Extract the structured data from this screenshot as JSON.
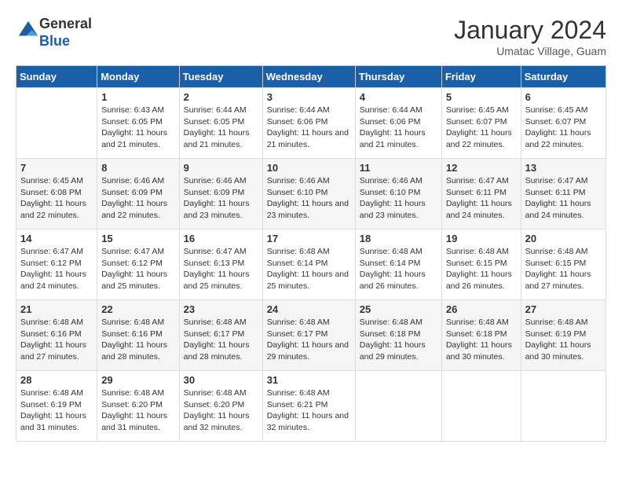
{
  "header": {
    "logo_line1": "General",
    "logo_line2": "Blue",
    "month": "January 2024",
    "location": "Umatac Village, Guam"
  },
  "days_of_week": [
    "Sunday",
    "Monday",
    "Tuesday",
    "Wednesday",
    "Thursday",
    "Friday",
    "Saturday"
  ],
  "weeks": [
    [
      {
        "num": "",
        "sunrise": "",
        "sunset": "",
        "daylight": ""
      },
      {
        "num": "1",
        "sunrise": "Sunrise: 6:43 AM",
        "sunset": "Sunset: 6:05 PM",
        "daylight": "Daylight: 11 hours and 21 minutes."
      },
      {
        "num": "2",
        "sunrise": "Sunrise: 6:44 AM",
        "sunset": "Sunset: 6:05 PM",
        "daylight": "Daylight: 11 hours and 21 minutes."
      },
      {
        "num": "3",
        "sunrise": "Sunrise: 6:44 AM",
        "sunset": "Sunset: 6:06 PM",
        "daylight": "Daylight: 11 hours and 21 minutes."
      },
      {
        "num": "4",
        "sunrise": "Sunrise: 6:44 AM",
        "sunset": "Sunset: 6:06 PM",
        "daylight": "Daylight: 11 hours and 21 minutes."
      },
      {
        "num": "5",
        "sunrise": "Sunrise: 6:45 AM",
        "sunset": "Sunset: 6:07 PM",
        "daylight": "Daylight: 11 hours and 22 minutes."
      },
      {
        "num": "6",
        "sunrise": "Sunrise: 6:45 AM",
        "sunset": "Sunset: 6:07 PM",
        "daylight": "Daylight: 11 hours and 22 minutes."
      }
    ],
    [
      {
        "num": "7",
        "sunrise": "Sunrise: 6:45 AM",
        "sunset": "Sunset: 6:08 PM",
        "daylight": "Daylight: 11 hours and 22 minutes."
      },
      {
        "num": "8",
        "sunrise": "Sunrise: 6:46 AM",
        "sunset": "Sunset: 6:09 PM",
        "daylight": "Daylight: 11 hours and 22 minutes."
      },
      {
        "num": "9",
        "sunrise": "Sunrise: 6:46 AM",
        "sunset": "Sunset: 6:09 PM",
        "daylight": "Daylight: 11 hours and 23 minutes."
      },
      {
        "num": "10",
        "sunrise": "Sunrise: 6:46 AM",
        "sunset": "Sunset: 6:10 PM",
        "daylight": "Daylight: 11 hours and 23 minutes."
      },
      {
        "num": "11",
        "sunrise": "Sunrise: 6:46 AM",
        "sunset": "Sunset: 6:10 PM",
        "daylight": "Daylight: 11 hours and 23 minutes."
      },
      {
        "num": "12",
        "sunrise": "Sunrise: 6:47 AM",
        "sunset": "Sunset: 6:11 PM",
        "daylight": "Daylight: 11 hours and 24 minutes."
      },
      {
        "num": "13",
        "sunrise": "Sunrise: 6:47 AM",
        "sunset": "Sunset: 6:11 PM",
        "daylight": "Daylight: 11 hours and 24 minutes."
      }
    ],
    [
      {
        "num": "14",
        "sunrise": "Sunrise: 6:47 AM",
        "sunset": "Sunset: 6:12 PM",
        "daylight": "Daylight: 11 hours and 24 minutes."
      },
      {
        "num": "15",
        "sunrise": "Sunrise: 6:47 AM",
        "sunset": "Sunset: 6:12 PM",
        "daylight": "Daylight: 11 hours and 25 minutes."
      },
      {
        "num": "16",
        "sunrise": "Sunrise: 6:47 AM",
        "sunset": "Sunset: 6:13 PM",
        "daylight": "Daylight: 11 hours and 25 minutes."
      },
      {
        "num": "17",
        "sunrise": "Sunrise: 6:48 AM",
        "sunset": "Sunset: 6:14 PM",
        "daylight": "Daylight: 11 hours and 25 minutes."
      },
      {
        "num": "18",
        "sunrise": "Sunrise: 6:48 AM",
        "sunset": "Sunset: 6:14 PM",
        "daylight": "Daylight: 11 hours and 26 minutes."
      },
      {
        "num": "19",
        "sunrise": "Sunrise: 6:48 AM",
        "sunset": "Sunset: 6:15 PM",
        "daylight": "Daylight: 11 hours and 26 minutes."
      },
      {
        "num": "20",
        "sunrise": "Sunrise: 6:48 AM",
        "sunset": "Sunset: 6:15 PM",
        "daylight": "Daylight: 11 hours and 27 minutes."
      }
    ],
    [
      {
        "num": "21",
        "sunrise": "Sunrise: 6:48 AM",
        "sunset": "Sunset: 6:16 PM",
        "daylight": "Daylight: 11 hours and 27 minutes."
      },
      {
        "num": "22",
        "sunrise": "Sunrise: 6:48 AM",
        "sunset": "Sunset: 6:16 PM",
        "daylight": "Daylight: 11 hours and 28 minutes."
      },
      {
        "num": "23",
        "sunrise": "Sunrise: 6:48 AM",
        "sunset": "Sunset: 6:17 PM",
        "daylight": "Daylight: 11 hours and 28 minutes."
      },
      {
        "num": "24",
        "sunrise": "Sunrise: 6:48 AM",
        "sunset": "Sunset: 6:17 PM",
        "daylight": "Daylight: 11 hours and 29 minutes."
      },
      {
        "num": "25",
        "sunrise": "Sunrise: 6:48 AM",
        "sunset": "Sunset: 6:18 PM",
        "daylight": "Daylight: 11 hours and 29 minutes."
      },
      {
        "num": "26",
        "sunrise": "Sunrise: 6:48 AM",
        "sunset": "Sunset: 6:18 PM",
        "daylight": "Daylight: 11 hours and 30 minutes."
      },
      {
        "num": "27",
        "sunrise": "Sunrise: 6:48 AM",
        "sunset": "Sunset: 6:19 PM",
        "daylight": "Daylight: 11 hours and 30 minutes."
      }
    ],
    [
      {
        "num": "28",
        "sunrise": "Sunrise: 6:48 AM",
        "sunset": "Sunset: 6:19 PM",
        "daylight": "Daylight: 11 hours and 31 minutes."
      },
      {
        "num": "29",
        "sunrise": "Sunrise: 6:48 AM",
        "sunset": "Sunset: 6:20 PM",
        "daylight": "Daylight: 11 hours and 31 minutes."
      },
      {
        "num": "30",
        "sunrise": "Sunrise: 6:48 AM",
        "sunset": "Sunset: 6:20 PM",
        "daylight": "Daylight: 11 hours and 32 minutes."
      },
      {
        "num": "31",
        "sunrise": "Sunrise: 6:48 AM",
        "sunset": "Sunset: 6:21 PM",
        "daylight": "Daylight: 11 hours and 32 minutes."
      },
      {
        "num": "",
        "sunrise": "",
        "sunset": "",
        "daylight": ""
      },
      {
        "num": "",
        "sunrise": "",
        "sunset": "",
        "daylight": ""
      },
      {
        "num": "",
        "sunrise": "",
        "sunset": "",
        "daylight": ""
      }
    ]
  ]
}
